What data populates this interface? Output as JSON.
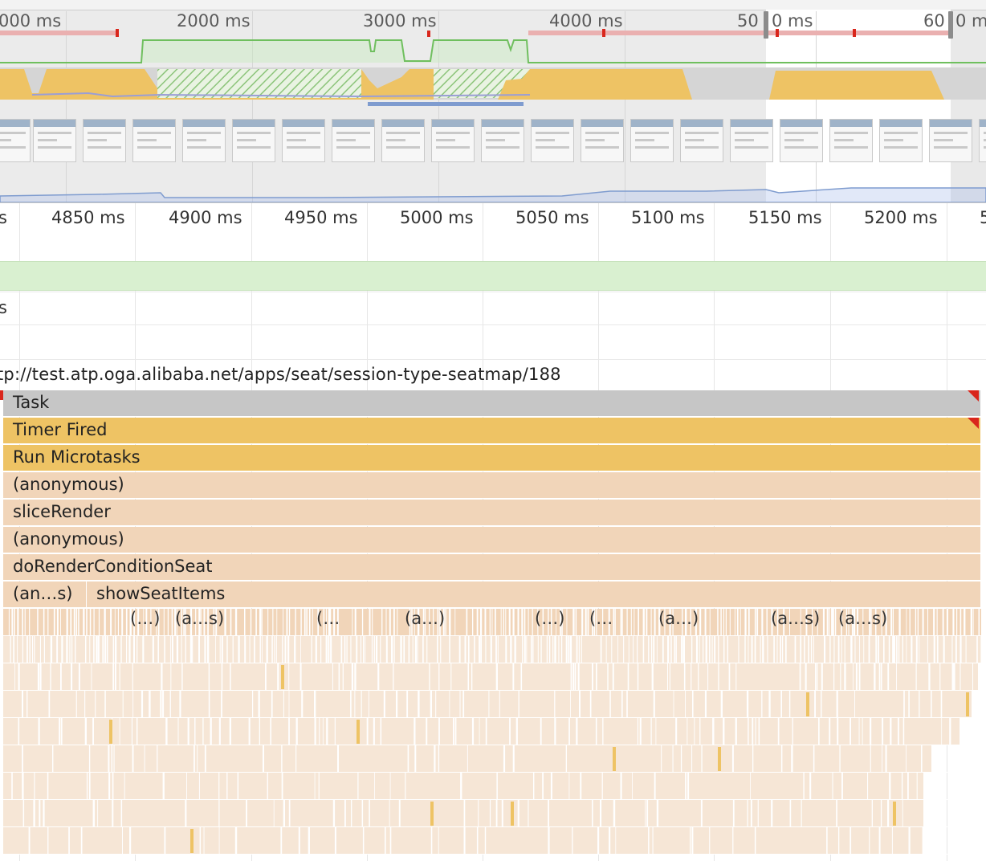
{
  "overview": {
    "ticks": [
      "000 ms",
      "2000 ms",
      "3000 ms",
      "4000 ms",
      "50",
      "0 ms",
      "60",
      "0 m"
    ],
    "colors": {
      "fps_line": "#6fbf5e",
      "scripting": "#eec364",
      "idle": "#d0d0d0",
      "network": "#7f9ccf",
      "long_task": "#e8a0a0"
    }
  },
  "detail": {
    "ticks": [
      "s",
      "4850 ms",
      "4900 ms",
      "4950 ms",
      "5000 ms",
      "5050 ms",
      "5100 ms",
      "5150 ms",
      "5200 ms",
      "5"
    ],
    "track_label": "s",
    "thread_url": "tp://test.atp.oga.alibaba.net/apps/seat/session-type-seatmap/188"
  },
  "flame": {
    "rows": [
      {
        "label": "Task",
        "kind": "task"
      },
      {
        "label": "Timer Fired",
        "kind": "timer"
      },
      {
        "label": "Run Microtasks",
        "kind": "micro"
      },
      {
        "label": "(anonymous)",
        "kind": "script"
      },
      {
        "label": "sliceRender",
        "kind": "script"
      },
      {
        "label": "(anonymous)",
        "kind": "script"
      },
      {
        "label": "doRenderConditionSeat",
        "kind": "script"
      }
    ],
    "row8": {
      "left": "(an…s)",
      "right": "showSeatItems"
    },
    "small_calls": [
      "(…)",
      "(a…s)",
      "(…",
      "(a…)",
      "(…)",
      "(…",
      "(a…)",
      "(a…s)",
      "(a…s)"
    ],
    "colors": {
      "task": "#c6c6c6",
      "timer": "#eec364",
      "script": "#f1d5b9",
      "script_light": "#f6e6d6",
      "warning": "#d9261c"
    }
  }
}
